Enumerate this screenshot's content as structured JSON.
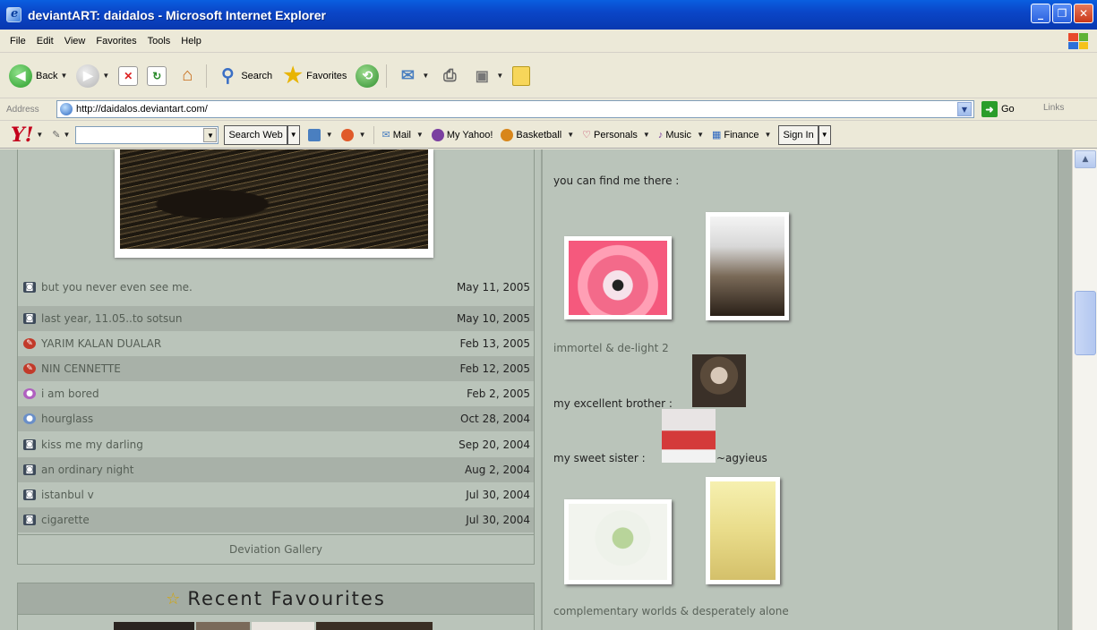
{
  "window": {
    "title": "deviantART: daidalos - Microsoft Internet Explorer"
  },
  "menu": [
    "File",
    "Edit",
    "View",
    "Favorites",
    "Tools",
    "Help"
  ],
  "toolbar": {
    "back_label": "Back",
    "search_label": "Search",
    "favorites_label": "Favorites"
  },
  "address": {
    "label": "Address",
    "url": "http://daidalos.deviantart.com/",
    "go_label": "Go",
    "links_label": "Links"
  },
  "yahoo": {
    "logo": "Y!",
    "search_button": "Search Web",
    "items": [
      "Mail",
      "My Yahoo!",
      "Basketball",
      "Personals",
      "Music",
      "Finance"
    ],
    "sign_in": "Sign In"
  },
  "deviations": [
    {
      "title": "but you never even see me.",
      "date": "May 11, 2005",
      "icon": "camera-icon"
    },
    {
      "title": "last year, 11.05..to sotsun",
      "date": "May 10, 2005",
      "icon": "camera-icon"
    },
    {
      "title": "YARIM KALAN DUALAR",
      "date": "Feb 13, 2005",
      "icon": "literature-icon"
    },
    {
      "title": "NIN CENNETTE",
      "date": "Feb 12, 2005",
      "icon": "literature-icon"
    },
    {
      "title": "i am bored",
      "date": "Feb 2, 2005",
      "icon": "paint-icon"
    },
    {
      "title": "hourglass",
      "date": "Oct 28, 2004",
      "icon": "mixed-media-icon"
    },
    {
      "title": "kiss me my darling",
      "date": "Sep 20, 2004",
      "icon": "camera-icon"
    },
    {
      "title": "an ordinary night",
      "date": "Aug 2, 2004",
      "icon": "camera-icon"
    },
    {
      "title": "istanbul v",
      "date": "Jul 30, 2004",
      "icon": "camera-icon"
    },
    {
      "title": "cigarette",
      "date": "Jul 30, 2004",
      "icon": "camera-icon"
    }
  ],
  "gallery_link": "Deviation Gallery",
  "favourites_title": "Recent Favourites",
  "right": {
    "find_me": "you can find me there :",
    "caption1": "immortel & de-light 2",
    "brother": "my excellent brother :",
    "sister": "my sweet sister :",
    "sister_name": "~agyieus",
    "caption2": "complementary worlds & desperately alone"
  },
  "colors": {
    "titlebar": "#0a46c8",
    "page_bg": "#bac4ba",
    "row_alt": "#a8b1a8"
  }
}
